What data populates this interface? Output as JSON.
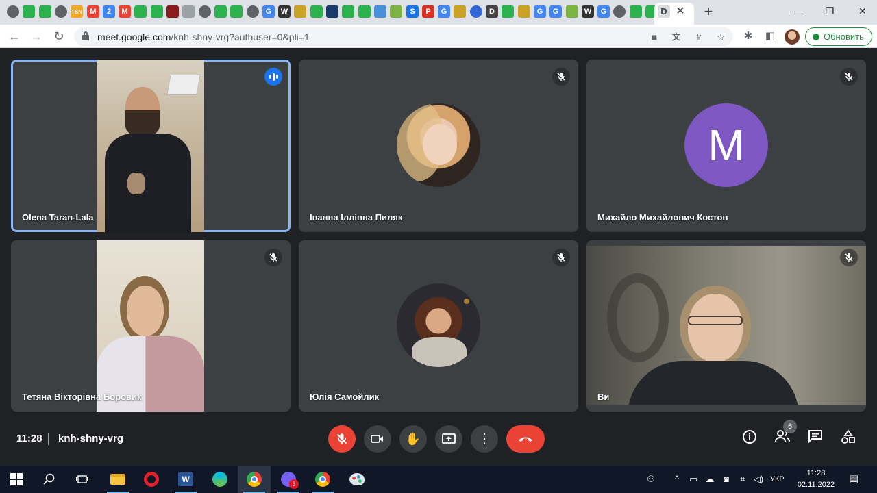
{
  "browser": {
    "tab_favicons": [
      {
        "name": "chrome",
        "label": "",
        "color": "#5f6368"
      },
      {
        "name": "feedly",
        "label": "",
        "color": "#2bb24c"
      },
      {
        "name": "feedly",
        "label": "",
        "color": "#2bb24c"
      },
      {
        "name": "chrome",
        "label": "",
        "color": "#5f6368"
      },
      {
        "name": "tsn",
        "label": "TSN",
        "color": "#f5a623"
      },
      {
        "name": "gmail",
        "label": "M",
        "color": "#ea4335"
      },
      {
        "name": "calendar",
        "label": "2",
        "color": "#4285f4"
      },
      {
        "name": "gmail",
        "label": "M",
        "color": "#ea4335"
      },
      {
        "name": "feedly",
        "label": "",
        "color": "#2bb24c"
      },
      {
        "name": "feedly",
        "label": "",
        "color": "#2bb24c"
      },
      {
        "name": "record",
        "label": "",
        "color": "#8b1a1a"
      },
      {
        "name": "page",
        "label": "",
        "color": "#9aa0a6"
      },
      {
        "name": "chrome",
        "label": "",
        "color": "#5f6368"
      },
      {
        "name": "feedly",
        "label": "",
        "color": "#2bb24c"
      },
      {
        "name": "feedly",
        "label": "",
        "color": "#2bb24c"
      },
      {
        "name": "chrome",
        "label": "",
        "color": "#5f6368"
      },
      {
        "name": "google",
        "label": "G",
        "color": "#4285f4"
      },
      {
        "name": "wikipedia",
        "label": "W",
        "color": "#333333"
      },
      {
        "name": "library",
        "label": "",
        "color": "#c9a227"
      },
      {
        "name": "feedly",
        "label": "",
        "color": "#2bb24c"
      },
      {
        "name": "site",
        "label": "",
        "color": "#1a3a6b"
      },
      {
        "name": "feedly",
        "label": "",
        "color": "#2bb24c"
      },
      {
        "name": "feedly",
        "label": "",
        "color": "#2bb24c"
      },
      {
        "name": "plane",
        "label": "",
        "color": "#4a90d9"
      },
      {
        "name": "leaf",
        "label": "",
        "color": "#7cb342"
      },
      {
        "name": "s",
        "label": "S",
        "color": "#1a73e8"
      },
      {
        "name": "pdf",
        "label": "P",
        "color": "#d93025"
      },
      {
        "name": "google",
        "label": "G",
        "color": "#4285f4"
      },
      {
        "name": "library",
        "label": "",
        "color": "#c9a227"
      },
      {
        "name": "globe",
        "label": "",
        "color": "#3367d6"
      },
      {
        "name": "d",
        "label": "D",
        "color": "#444444"
      },
      {
        "name": "feedly",
        "label": "",
        "color": "#2bb24c"
      },
      {
        "name": "library",
        "label": "",
        "color": "#c9a227"
      },
      {
        "name": "google",
        "label": "G",
        "color": "#4285f4"
      },
      {
        "name": "google",
        "label": "G",
        "color": "#4285f4"
      },
      {
        "name": "leaf",
        "label": "",
        "color": "#7cb342"
      },
      {
        "name": "wikipedia",
        "label": "W",
        "color": "#333333"
      },
      {
        "name": "google",
        "label": "G",
        "color": "#4285f4"
      },
      {
        "name": "chrome",
        "label": "",
        "color": "#5f6368"
      },
      {
        "name": "feedly",
        "label": "",
        "color": "#2bb24c"
      },
      {
        "name": "feedly",
        "label": "",
        "color": "#2bb24c"
      },
      {
        "name": "library",
        "label": "",
        "color": "#c9a227"
      },
      {
        "name": "d",
        "label": "D",
        "color": "#444444"
      }
    ],
    "url_host": "meet.google.com",
    "url_path": "/knh-shny-vrg?authuser=0&pli=1",
    "update_label": "Обновить"
  },
  "meet": {
    "participants": [
      {
        "name": "Olena Taran-Lala",
        "type": "video",
        "speaking": true
      },
      {
        "name": "Іванна Іллівна Пиляк",
        "type": "photo"
      },
      {
        "name": "Михайло Михайлович Костов",
        "type": "letter",
        "letter": "M",
        "color": "#7e57c2"
      },
      {
        "name": "Тетяна Вікторівна Боровик",
        "type": "video"
      },
      {
        "name": "Юлія Самойлик",
        "type": "photo"
      },
      {
        "name": "Ви",
        "type": "video"
      }
    ],
    "time": "11:28",
    "code": "knh-shny-vrg",
    "participant_count": "6"
  },
  "taskbar": {
    "lang": "УКР",
    "time": "11:28",
    "date": "02.11.2022",
    "viber_badge": "3"
  },
  "colors": {
    "meet_bg": "#202124",
    "tile_bg": "#3c4043",
    "speaking_outline": "#8ab4f8",
    "end_call": "#ea4335"
  }
}
